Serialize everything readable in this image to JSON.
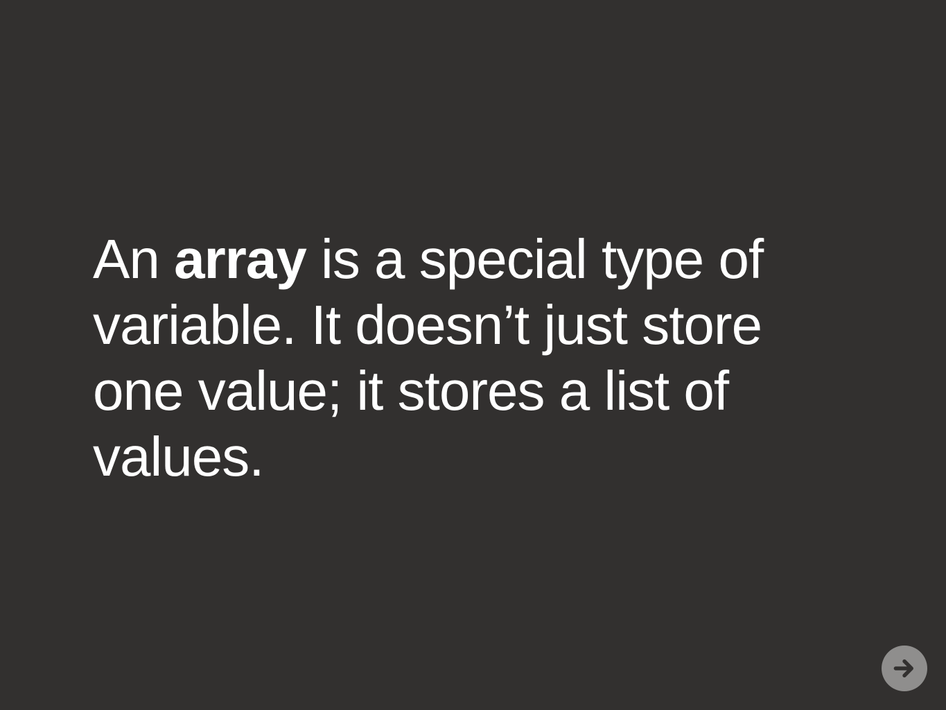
{
  "slide": {
    "lines": [
      {
        "pre": "An ",
        "bold": "array",
        "post": " is a special type of"
      },
      {
        "text": "variable. It doesn’t just store"
      },
      {
        "text": "one value; it stores a list of"
      },
      {
        "text": "values."
      }
    ]
  },
  "navigation": {
    "next_icon": "arrow-right-icon"
  },
  "colors": {
    "background": "#32302f",
    "text": "#ffffff",
    "button": "#8f8e8d",
    "button_icon": "#32302f"
  }
}
